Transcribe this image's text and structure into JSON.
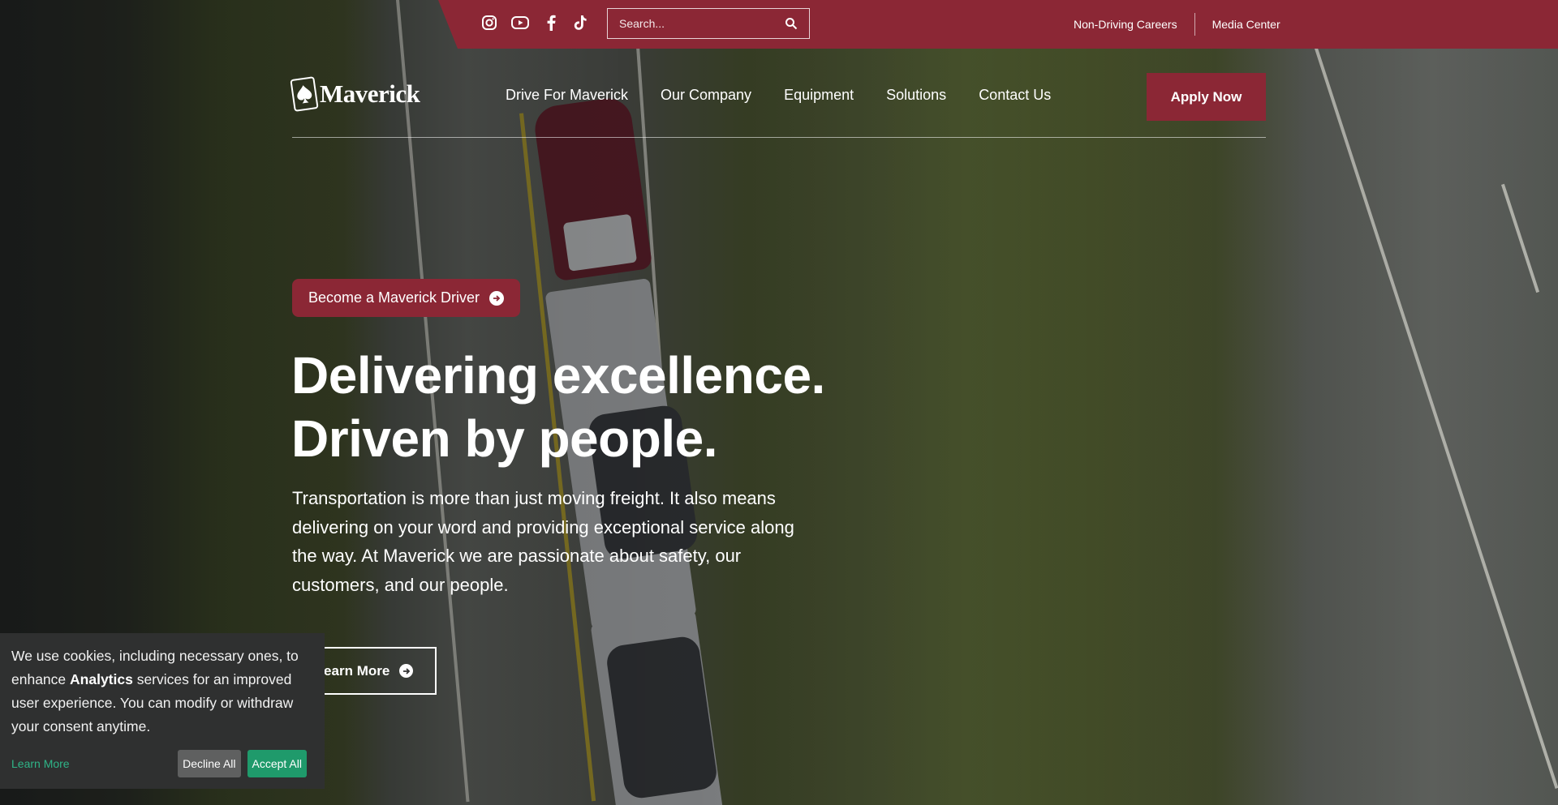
{
  "topbar": {
    "social": [
      "instagram-icon",
      "youtube-icon",
      "facebook-icon",
      "tiktok-icon"
    ],
    "search_placeholder": "Search...",
    "links": [
      "Non-Driving Careers",
      "Media Center"
    ]
  },
  "header": {
    "logo_text": "Maverick",
    "nav": [
      "Drive For Maverick",
      "Our Company",
      "Equipment",
      "Solutions",
      "Contact Us"
    ],
    "cta": "Apply Now"
  },
  "hero": {
    "pill": "Become a Maverick Driver",
    "headline_line1": "Delivering excellence.",
    "headline_line2": "Driven by people.",
    "body": "Transportation is more than just moving freight. It also means delivering on your word and providing exceptional service along the way. At Maverick we are passionate about safety, our customers, and our people.",
    "learn_more": "Learn More"
  },
  "cookie": {
    "text_before": "We use cookies, including necessary ones, to enhance ",
    "text_bold": "Analytics",
    "text_after": " services for an improved user experience. You can modify or withdraw your consent anytime.",
    "learn_more": "Learn More",
    "decline": "Decline All",
    "accept": "Accept All"
  },
  "colors": {
    "brand": "#8b2735",
    "accept": "#1f9a6b",
    "learn_link": "#2fb487"
  }
}
